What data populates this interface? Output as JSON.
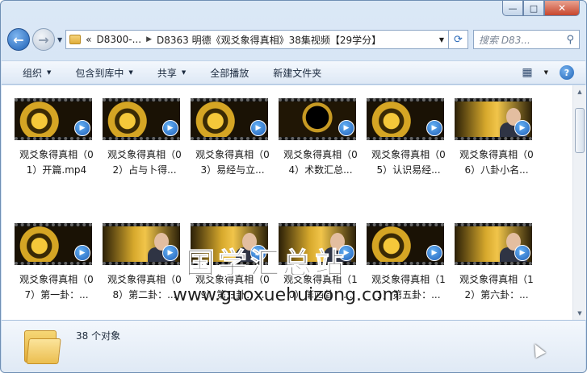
{
  "window": {
    "caption": {
      "minimize_glyph": "—",
      "maximize_glyph": "□",
      "close_glyph": "✕"
    }
  },
  "address_bar": {
    "back_glyph": "←",
    "forward_glyph": "→",
    "overflow_glyph": "«",
    "crumbs": [
      "D8300-...",
      "D8363 明德《观爻象得真相》38集视频【29学分】"
    ],
    "refresh_glyph": "⟳",
    "search_placeholder": "搜索 D83..."
  },
  "toolbar": {
    "organize": "组织",
    "include_in_library": "包含到库中",
    "share": "共享",
    "play_all": "全部播放",
    "new_folder": "新建文件夹"
  },
  "files": [
    {
      "name": "观爻象得真相（01）开篇.mp4",
      "thumb": "gold"
    },
    {
      "name": "观爻象得真相（02）占与卜得...",
      "thumb": "gold"
    },
    {
      "name": "观爻象得真相（03）易经与立...",
      "thumb": "gold"
    },
    {
      "name": "观爻象得真相（04）术数汇总...",
      "thumb": "dark"
    },
    {
      "name": "观爻象得真相（05）认识易经...",
      "thumb": "gold"
    },
    {
      "name": "观爻象得真相（06）八卦小名...",
      "thumb": "person"
    },
    {
      "name": "观爻象得真相（07）第一卦：...",
      "thumb": "gold"
    },
    {
      "name": "观爻象得真相（08）第二卦：...",
      "thumb": "person"
    },
    {
      "name": "观爻象得真相（09）第三卦：...",
      "thumb": "person"
    },
    {
      "name": "观爻象得真相（10）第四卦：...",
      "thumb": "person"
    },
    {
      "name": "观爻象得真相（11）第五卦：...",
      "thumb": "gold"
    },
    {
      "name": "观爻象得真相（12）第六卦：...",
      "thumb": "person"
    }
  ],
  "watermark": {
    "title": "国学汇总站",
    "url": "www.guoxuehuizong.com"
  },
  "details": {
    "object_count": "38 个对象"
  },
  "colors": {
    "accent": "#1f63b6",
    "frame": "#c9dcf1"
  }
}
